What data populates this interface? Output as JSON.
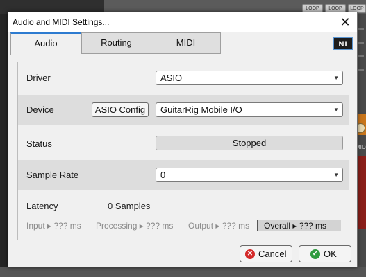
{
  "dialog": {
    "title": "Audio and MIDI Settings...",
    "close_glyph": "✕",
    "logo_text": "NI"
  },
  "tabs": [
    {
      "label": "Audio",
      "active": true
    },
    {
      "label": "Routing",
      "active": false
    },
    {
      "label": "MIDI",
      "active": false
    }
  ],
  "audio": {
    "driver": {
      "label": "Driver",
      "value": "ASIO"
    },
    "device": {
      "label": "Device",
      "config_button": "ASIO Config",
      "value": "GuitarRig Mobile I/O"
    },
    "status": {
      "label": "Status",
      "value": "Stopped"
    },
    "sample_rate": {
      "label": "Sample Rate",
      "value": "0"
    },
    "latency": {
      "label": "Latency",
      "value": "0 Samples"
    },
    "io_latency": {
      "input": "Input ▸ ??? ms",
      "processing": "Processing  ▸ ??? ms",
      "output": "Output ▸ ??? ms",
      "overall": "Overall  ▸ ??? ms"
    }
  },
  "buttons": {
    "cancel": "Cancel",
    "ok": "OK"
  },
  "background": {
    "buttons": [
      "LOOP",
      "LOOP",
      "LOOP"
    ],
    "side_label": "MID"
  },
  "icons": {
    "dropdown": "chevron-down-icon",
    "cancel": "cancel-icon",
    "ok": "check-icon"
  },
  "colors": {
    "active_tab_accent": "#2d7bd0",
    "cancel_icon": "#d42a2a",
    "ok_icon": "#2f9b3f"
  }
}
